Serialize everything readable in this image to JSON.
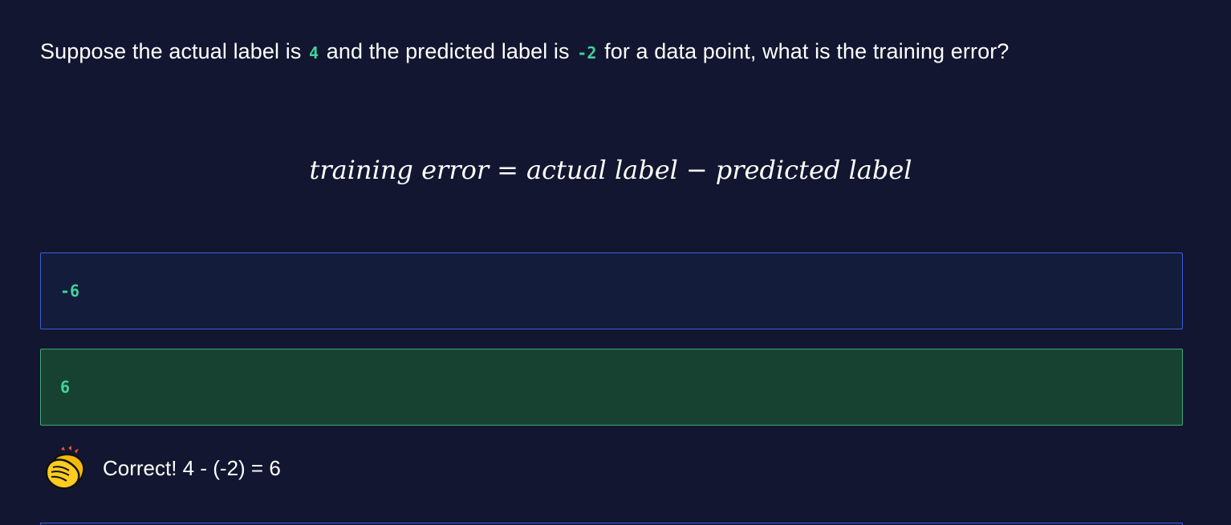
{
  "question": {
    "part1": "Suppose the actual label is",
    "actual_value": "4",
    "part2": "and the predicted label is",
    "predicted_value": "-2",
    "part3": "for a data point, what is the training error?"
  },
  "formula": {
    "lhs": "training error",
    "equals": "=",
    "term1": "actual label",
    "minus": "−",
    "term2": "predicted label"
  },
  "options": [
    {
      "label": "-6",
      "state": "unselected"
    },
    {
      "label": "6",
      "state": "correct"
    }
  ],
  "feedback": {
    "icon": "clapping-hands-icon",
    "text": "Correct! 4 - (-2) = 6"
  },
  "colors": {
    "background": "#121630",
    "code_accent": "#41d39a",
    "option_border": "#3a5fd6",
    "correct_bg": "#174232",
    "correct_border": "#3fa878"
  }
}
